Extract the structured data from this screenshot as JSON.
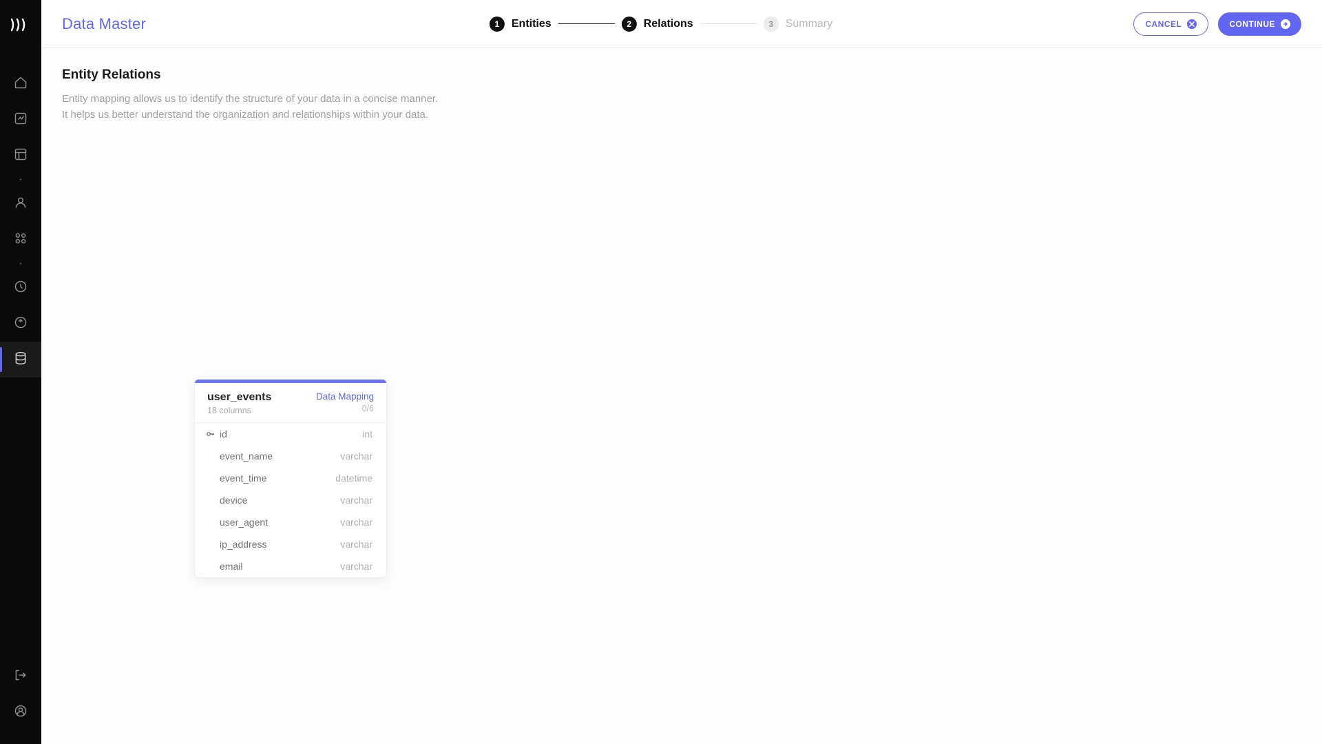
{
  "app_title": "Data Master",
  "header": {
    "cancel_label": "CANCEL",
    "continue_label": "CONTINUE"
  },
  "stepper": {
    "steps": [
      {
        "num": "1",
        "label": "Entities",
        "state": "done"
      },
      {
        "num": "2",
        "label": "Relations",
        "state": "done"
      },
      {
        "num": "3",
        "label": "Summary",
        "state": "pending"
      }
    ]
  },
  "page": {
    "title": "Entity Relations",
    "desc_line1": "Entity mapping allows us to identify the structure of your data in a concise manner.",
    "desc_line2": "It helps us better understand the organization and relationships within your data."
  },
  "entity_card": {
    "name": "user_events",
    "sub": "18 columns",
    "mapping_label": "Data Mapping",
    "mapping_count": "0/6",
    "columns": [
      {
        "key": true,
        "name": "id",
        "type": "int"
      },
      {
        "key": false,
        "name": "event_name",
        "type": "varchar"
      },
      {
        "key": false,
        "name": "event_time",
        "type": "datetime"
      },
      {
        "key": false,
        "name": "device",
        "type": "varchar"
      },
      {
        "key": false,
        "name": "user_agent",
        "type": "varchar"
      },
      {
        "key": false,
        "name": "ip_address",
        "type": "varchar"
      },
      {
        "key": false,
        "name": "email",
        "type": "varchar"
      }
    ]
  },
  "sidebar": {
    "icons": [
      "home-icon",
      "dashboard-icon",
      "layout-icon",
      "users-icon",
      "components-icon",
      "activity-icon",
      "share-icon"
    ],
    "active_index": 7,
    "active_icon": "database-icon",
    "bottom_icons": [
      "logout-icon",
      "profile-icon"
    ]
  }
}
